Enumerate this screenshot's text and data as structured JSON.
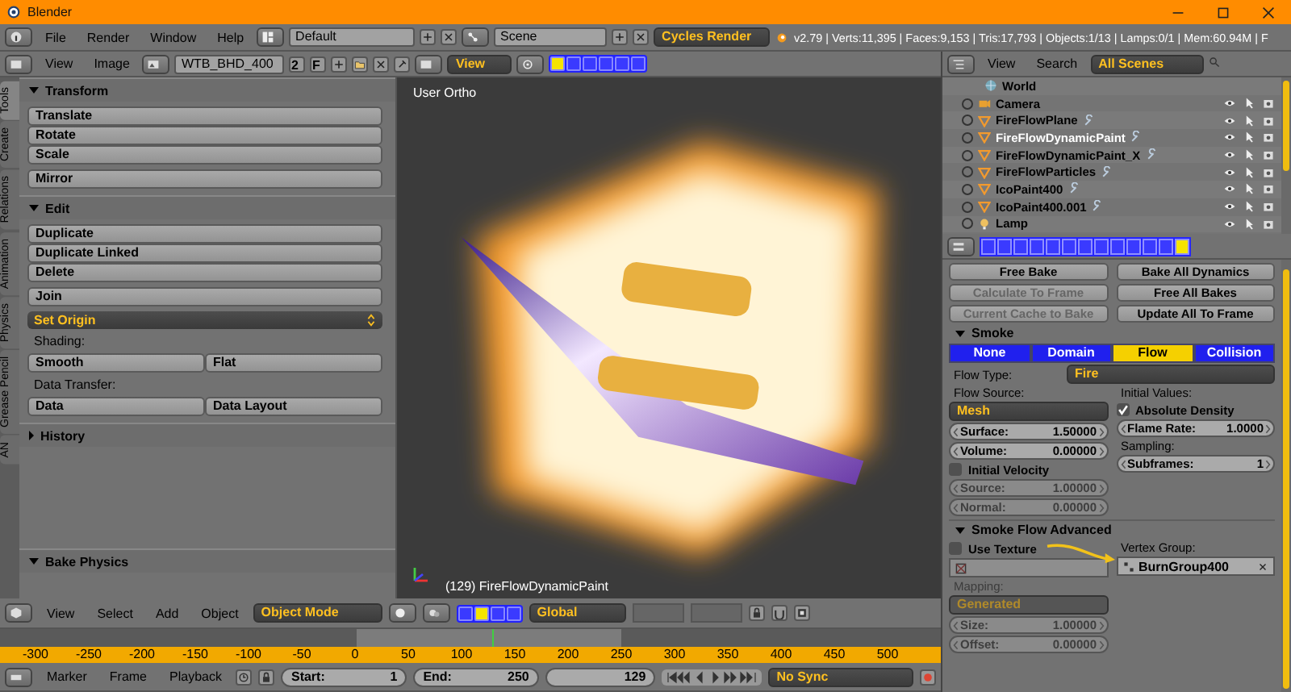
{
  "window": {
    "title": "Blender"
  },
  "info_bar": {
    "menus": [
      "File",
      "Render",
      "Window",
      "Help"
    ],
    "layout": "Default",
    "scene": "Scene",
    "render_engine": "Cycles Render",
    "stats": "v2.79 | Verts:11,395 | Faces:9,153 | Tris:17,793 | Objects:1/13 | Lamps:0/1 | Mem:60.94M | F"
  },
  "image_header": {
    "menus": [
      "View",
      "Image"
    ],
    "image": "WTB_BHD_400",
    "users": "2",
    "fake_user": "F",
    "view": "View"
  },
  "tool_tabs": [
    {
      "label": "Tools",
      "selected": true
    },
    {
      "label": "Create",
      "selected": false
    },
    {
      "label": "Relations",
      "selected": false
    },
    {
      "label": "Animation",
      "selected": false
    },
    {
      "label": "Physics",
      "selected": false
    },
    {
      "label": "Grease Pencil",
      "selected": false
    },
    {
      "label": "AN",
      "selected": false
    }
  ],
  "tool_panels": [
    {
      "title": "Transform",
      "expanded": true,
      "items": [
        {
          "kind": "stack",
          "buttons": [
            "Translate",
            "Rotate",
            "Scale"
          ]
        },
        {
          "kind": "stack",
          "buttons": [
            "Mirror"
          ]
        }
      ]
    },
    {
      "title": "Edit",
      "expanded": true,
      "items": [
        {
          "kind": "stack",
          "buttons": [
            "Duplicate",
            "Duplicate Linked",
            "Delete"
          ]
        },
        {
          "kind": "stack",
          "buttons": [
            "Join"
          ]
        },
        {
          "kind": "dropdown",
          "label": "Set Origin"
        },
        {
          "kind": "label",
          "label": "Shading:"
        },
        {
          "kind": "pair",
          "buttons": [
            "Smooth",
            "Flat"
          ]
        },
        {
          "kind": "label",
          "label": "Data Transfer:"
        },
        {
          "kind": "pair",
          "buttons": [
            "Data",
            "Data Layout"
          ]
        }
      ]
    },
    {
      "title": "History",
      "expanded": false
    }
  ],
  "bottom_panel": {
    "title": "Bake Physics",
    "expanded": true
  },
  "viewport": {
    "view_label": "User Ortho",
    "object_info": "(129) FireFlowDynamicPaint"
  },
  "view3d_header": {
    "menus": [
      "View",
      "Select",
      "Add",
      "Object"
    ],
    "mode": "Object Mode",
    "orientation": "Global"
  },
  "timeline": {
    "ticks": [
      "-300",
      "-250",
      "-200",
      "-150",
      "-100",
      "-50",
      "0",
      "50",
      "100",
      "150",
      "200",
      "250",
      "300",
      "350",
      "400",
      "450",
      "500"
    ],
    "menus": [
      "Marker",
      "Frame",
      "Playback"
    ],
    "start_label": "Start:",
    "start": "1",
    "end_label": "End:",
    "end": "250",
    "current_frame": "129",
    "sync": "No Sync"
  },
  "outliner": {
    "menus": [
      "View",
      "Search"
    ],
    "scope": "All Scenes",
    "items": [
      {
        "name": "World",
        "kind": "world",
        "selected": false
      },
      {
        "name": "Camera",
        "kind": "camera",
        "selected": false
      },
      {
        "name": "FireFlowPlane",
        "kind": "mesh",
        "selected": false
      },
      {
        "name": "FireFlowDynamicPaint",
        "kind": "mesh",
        "selected": true
      },
      {
        "name": "FireFlowDynamicPaint_X",
        "kind": "mesh",
        "selected": false
      },
      {
        "name": "FireFlowParticles",
        "kind": "mesh",
        "selected": false
      },
      {
        "name": "IcoPaint400",
        "kind": "mesh",
        "selected": false
      },
      {
        "name": "IcoPaint400.001",
        "kind": "mesh",
        "selected": false
      },
      {
        "name": "Lamp",
        "kind": "lamp",
        "selected": false
      }
    ]
  },
  "context_tabs": [
    {
      "selected": false
    },
    {
      "selected": false
    },
    {
      "selected": false
    },
    {
      "selected": false
    },
    {
      "selected": false
    },
    {
      "selected": false
    },
    {
      "selected": false
    },
    {
      "selected": false
    },
    {
      "selected": false
    },
    {
      "selected": false
    },
    {
      "selected": false
    },
    {
      "selected": false
    },
    {
      "selected": true
    }
  ],
  "bake_buttons": [
    {
      "label": "Free Bake",
      "disabled": false
    },
    {
      "label": "Bake All Dynamics",
      "disabled": false
    },
    {
      "label": "Calculate To Frame",
      "disabled": true
    },
    {
      "label": "Free All Bakes",
      "disabled": false
    },
    {
      "label": "Current Cache to Bake",
      "disabled": true
    },
    {
      "label": "Update All To Frame",
      "disabled": false
    }
  ],
  "smoke": {
    "title": "Smoke",
    "expanded": true,
    "types": [
      {
        "label": "None",
        "selected": false
      },
      {
        "label": "Domain",
        "selected": false
      },
      {
        "label": "Flow",
        "selected": true
      },
      {
        "label": "Collision",
        "selected": false
      }
    ],
    "flow_type_label": "Flow Type:",
    "flow_type": "Fire",
    "flow_source_label": "Flow Source:",
    "flow_source": "Mesh",
    "initial_values_label": "Initial Values:",
    "absolute_density": {
      "label": "Absolute Density",
      "checked": true
    },
    "surface": {
      "label": "Surface:",
      "value": "1.50000",
      "disabled": false
    },
    "flame_rate": {
      "label": "Flame Rate:",
      "value": "1.0000",
      "disabled": false
    },
    "volume": {
      "label": "Volume:",
      "value": "0.00000",
      "disabled": false
    },
    "sampling_label": "Sampling:",
    "initial_velocity": {
      "label": "Initial Velocity",
      "checked": false
    },
    "subframes": {
      "label": "Subframes:",
      "value": "1",
      "disabled": false
    },
    "source": {
      "label": "Source:",
      "value": "1.00000",
      "disabled": true
    },
    "normal": {
      "label": "Normal:",
      "value": "0.00000",
      "disabled": true
    }
  },
  "advanced": {
    "title": "Smoke Flow Advanced",
    "expanded": true,
    "use_texture": {
      "label": "Use Texture",
      "checked": false
    },
    "vertex_group_label": "Vertex Group:",
    "vertex_group": "BurnGroup400",
    "mapping_label": "Mapping:",
    "mapping": "Generated",
    "mapping_disabled": true,
    "size": {
      "label": "Size:",
      "value": "1.00000",
      "disabled": true
    },
    "offset": {
      "label": "Offset:",
      "value": "0.00000",
      "disabled": true
    }
  }
}
